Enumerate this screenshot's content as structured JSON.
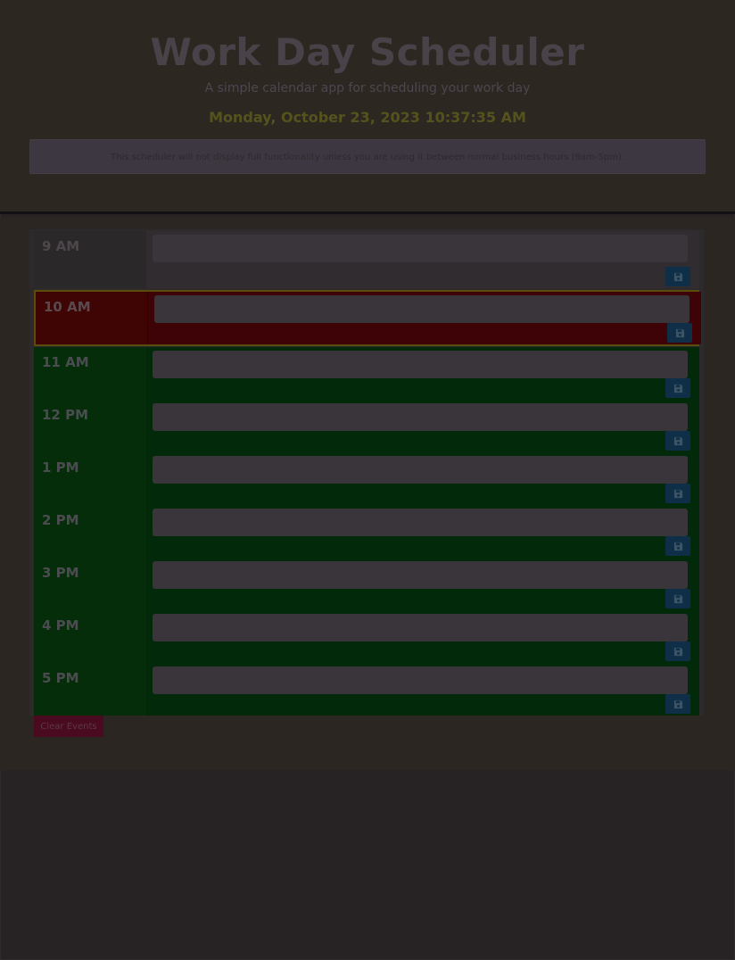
{
  "header": {
    "title": "Work Day Scheduler",
    "subtitle": "A simple calendar app for scheduling your work day",
    "current_date": "Monday, October 23, 2023 10:37:35 AM",
    "notice": "This scheduler will not display full functionality unless you are using it between normal business hours (9am-5pm)."
  },
  "schedule": {
    "rows": [
      {
        "hour": "9 AM",
        "status": "past",
        "description": ""
      },
      {
        "hour": "10 AM",
        "status": "present",
        "description": ""
      },
      {
        "hour": "11 AM",
        "status": "future",
        "description": ""
      },
      {
        "hour": "12 PM",
        "status": "future",
        "description": ""
      },
      {
        "hour": "1 PM",
        "status": "future",
        "description": ""
      },
      {
        "hour": "2 PM",
        "status": "future",
        "description": ""
      },
      {
        "hour": "3 PM",
        "status": "future",
        "description": ""
      },
      {
        "hour": "4 PM",
        "status": "future",
        "description": ""
      },
      {
        "hour": "5 PM",
        "status": "future",
        "description": ""
      }
    ],
    "save_icon": "floppy-disk-icon"
  },
  "actions": {
    "clear_label": "Clear Events"
  },
  "colors": {
    "past": "#2b2829",
    "present": "#3d0307",
    "future": "#03290b",
    "save_button": "#0f2f48",
    "clear_button": "#4a0a20"
  }
}
